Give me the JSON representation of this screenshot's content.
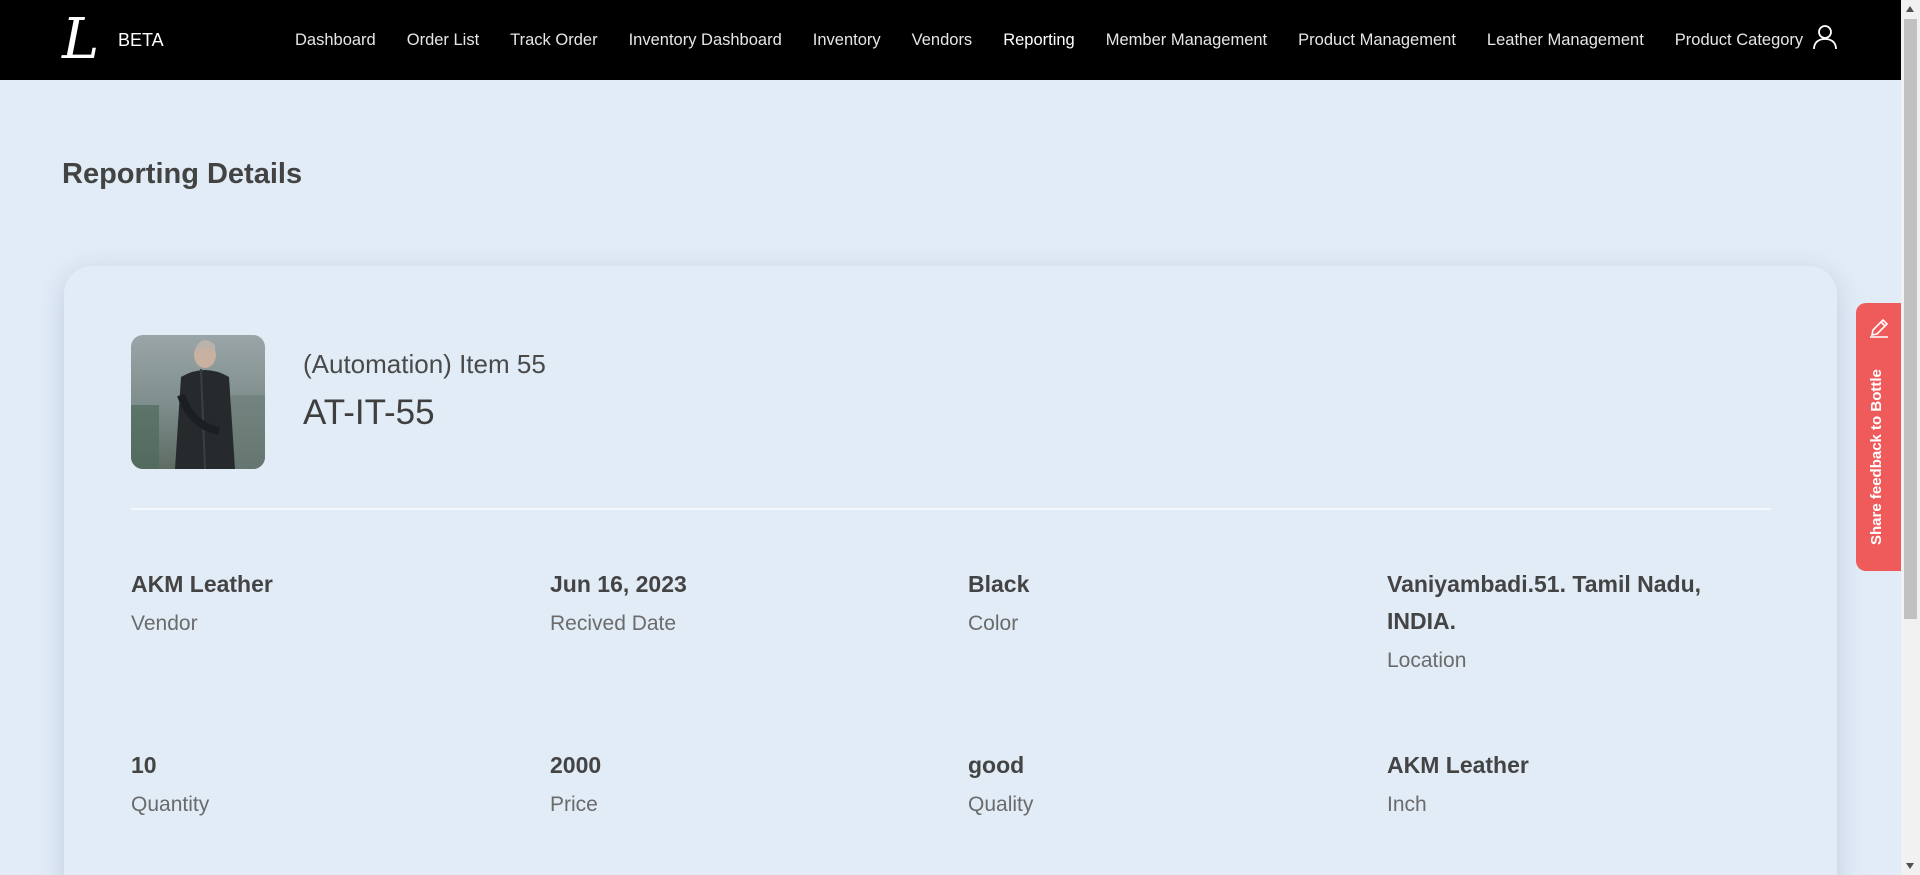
{
  "header": {
    "logo_letter": "L",
    "logo_badge": "BETA",
    "nav": [
      {
        "label": "Dashboard"
      },
      {
        "label": "Order List"
      },
      {
        "label": "Track Order"
      },
      {
        "label": "Inventory Dashboard"
      },
      {
        "label": "Inventory"
      },
      {
        "label": "Vendors"
      },
      {
        "label": "Reporting",
        "active": true
      },
      {
        "label": "Member Management"
      },
      {
        "label": "Product Management"
      },
      {
        "label": "Leather Management"
      },
      {
        "label": "Product Category"
      }
    ],
    "user_icon": "user-icon"
  },
  "page": {
    "title": "Reporting Details"
  },
  "product": {
    "name": "(Automation) Item 55",
    "code": "AT-IT-55"
  },
  "details": {
    "row1": [
      {
        "value": "AKM Leather",
        "label": "Vendor"
      },
      {
        "value": "Jun 16, 2023",
        "label": "Recived Date"
      },
      {
        "value": "Black",
        "label": "Color"
      },
      {
        "value": "Vaniyambadi.51. Tamil Nadu, INDIA.",
        "label": "Location"
      }
    ],
    "row2": [
      {
        "value": "10",
        "label": "Quantity"
      },
      {
        "value": "2000",
        "label": "Price"
      },
      {
        "value": "good",
        "label": "Quality"
      },
      {
        "value": "AKM Leather",
        "label": "Inch"
      }
    ]
  },
  "feedback": {
    "label": "Share feedback to Bottle",
    "icon": "pencil-icon"
  },
  "colors": {
    "nav_bg": "#000000",
    "page_bg": "#e1ecf7",
    "feedback_bg": "#ef5b5b"
  }
}
